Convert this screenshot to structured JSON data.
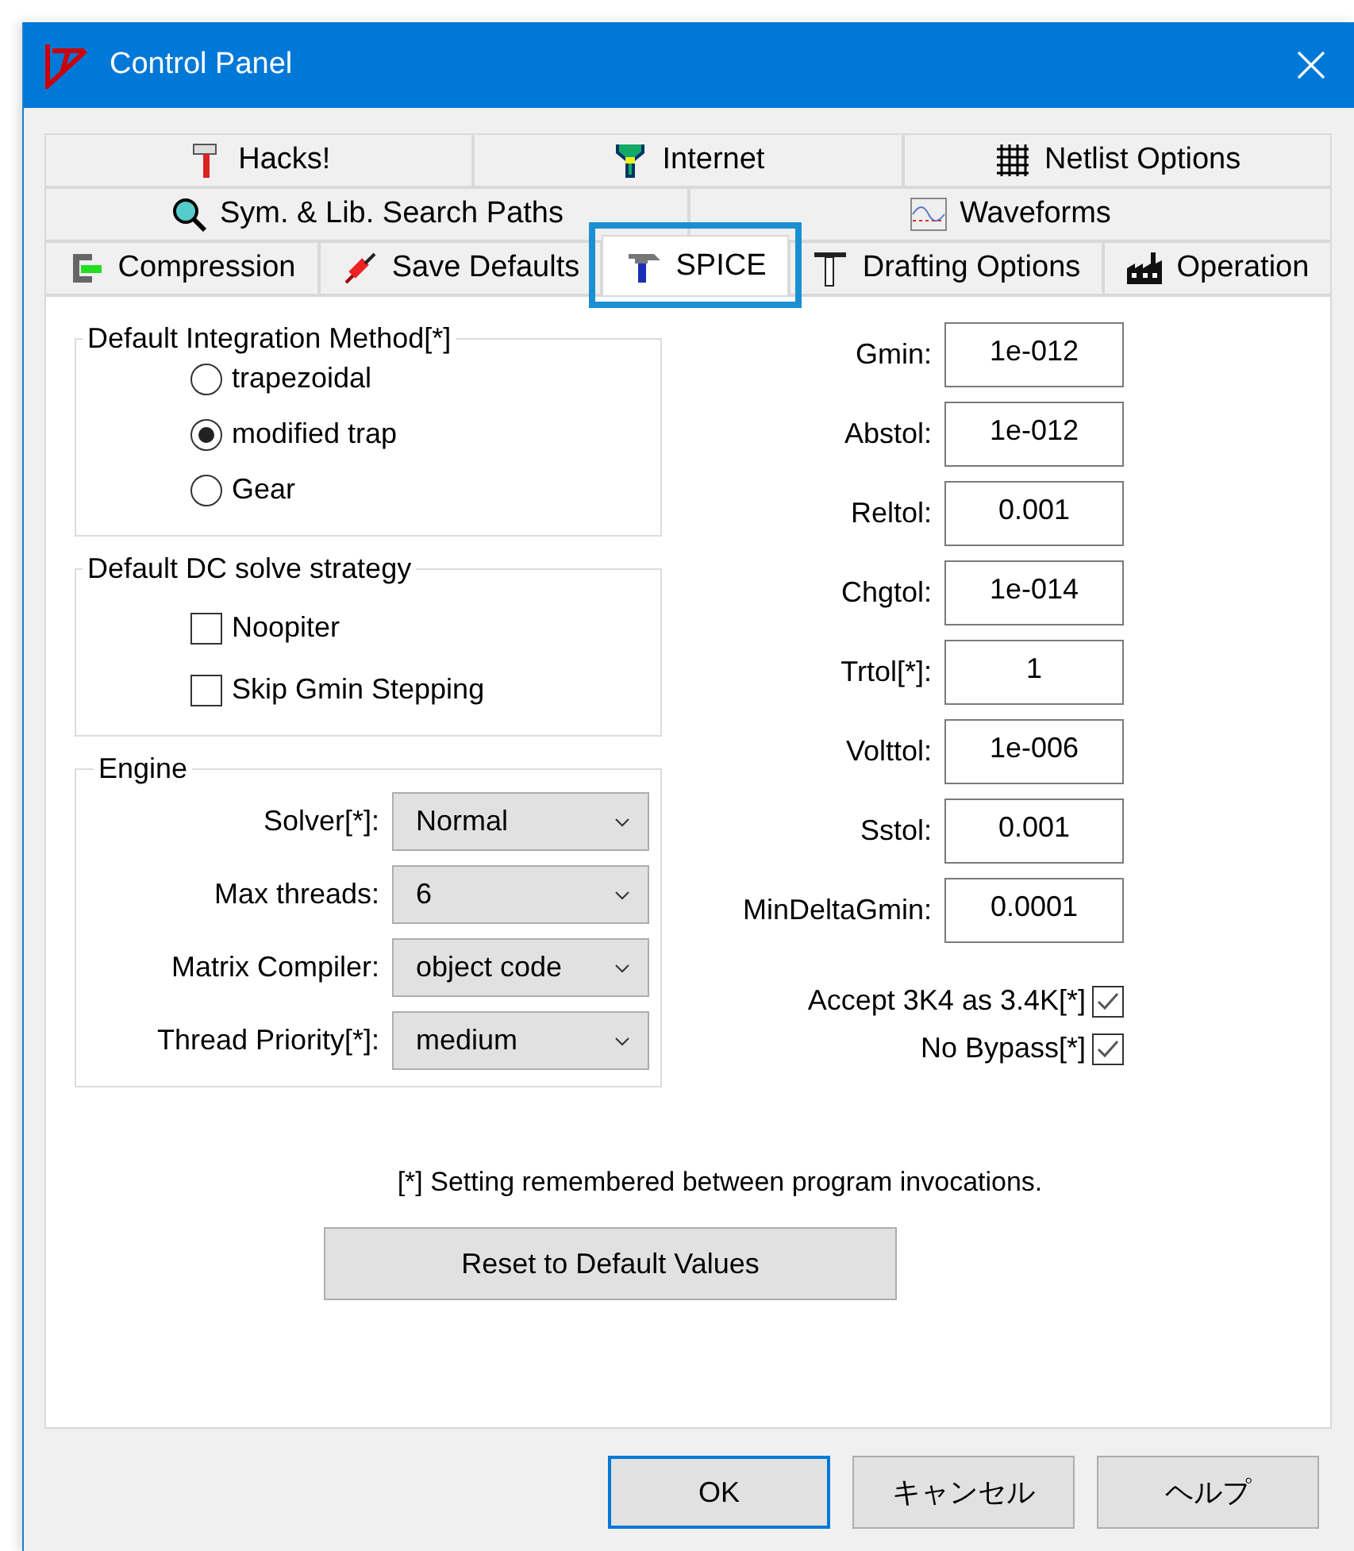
{
  "window": {
    "title": "Control Panel"
  },
  "tab_rows": [
    [
      {
        "label": "Hacks!",
        "selected": false
      },
      {
        "label": "Internet",
        "selected": false
      },
      {
        "label": "Netlist Options",
        "selected": false
      }
    ],
    [
      {
        "label": "Sym. & Lib. Search Paths",
        "selected": false
      },
      {
        "label": "Waveforms",
        "selected": false
      }
    ],
    [
      {
        "label": "Compression",
        "selected": false
      },
      {
        "label": "Save Defaults",
        "selected": false
      },
      {
        "label": "SPICE",
        "selected": true
      },
      {
        "label": "Drafting Options",
        "selected": false
      },
      {
        "label": "Operation",
        "selected": false
      }
    ]
  ],
  "integration_group": {
    "title": "Default Integration Method[*]",
    "options": [
      {
        "label": "trapezoidal",
        "selected": false
      },
      {
        "label": "modified trap",
        "selected": true
      },
      {
        "label": "Gear",
        "selected": false
      }
    ]
  },
  "dc_group": {
    "title": "Default DC solve strategy",
    "options": [
      {
        "label": "Noopiter",
        "checked": false
      },
      {
        "label": "Skip Gmin Stepping",
        "checked": false
      }
    ]
  },
  "engine_group": {
    "title": "Engine",
    "fields": [
      {
        "label": "Solver[*]:",
        "value": "Normal"
      },
      {
        "label": "Max threads:",
        "value": "6"
      },
      {
        "label": "Matrix Compiler:",
        "value": "object code"
      },
      {
        "label": "Thread Priority[*]:",
        "value": "medium"
      }
    ]
  },
  "tolerances": [
    {
      "label": "Gmin:",
      "value": "1e-012"
    },
    {
      "label": "Abstol:",
      "value": "1e-012"
    },
    {
      "label": "Reltol:",
      "value": "0.001"
    },
    {
      "label": "Chgtol:",
      "value": "1e-014"
    },
    {
      "label": "Trtol[*]:",
      "value": "1"
    },
    {
      "label": "Volttol:",
      "value": "1e-006"
    },
    {
      "label": "Sstol:",
      "value": "0.001"
    },
    {
      "label": "MinDeltaGmin:",
      "value": "0.0001"
    }
  ],
  "flags": [
    {
      "label": "Accept 3K4 as 3.4K[*]",
      "checked": true
    },
    {
      "label": "No Bypass[*]",
      "checked": true
    }
  ],
  "note": "[*] Setting remembered between program invocations.",
  "reset_button": "Reset to Default Values",
  "buttons": [
    {
      "label": "OK",
      "default": true
    },
    {
      "label": "キャンセル",
      "default": false
    },
    {
      "label": "ヘルプ",
      "default": false
    }
  ]
}
